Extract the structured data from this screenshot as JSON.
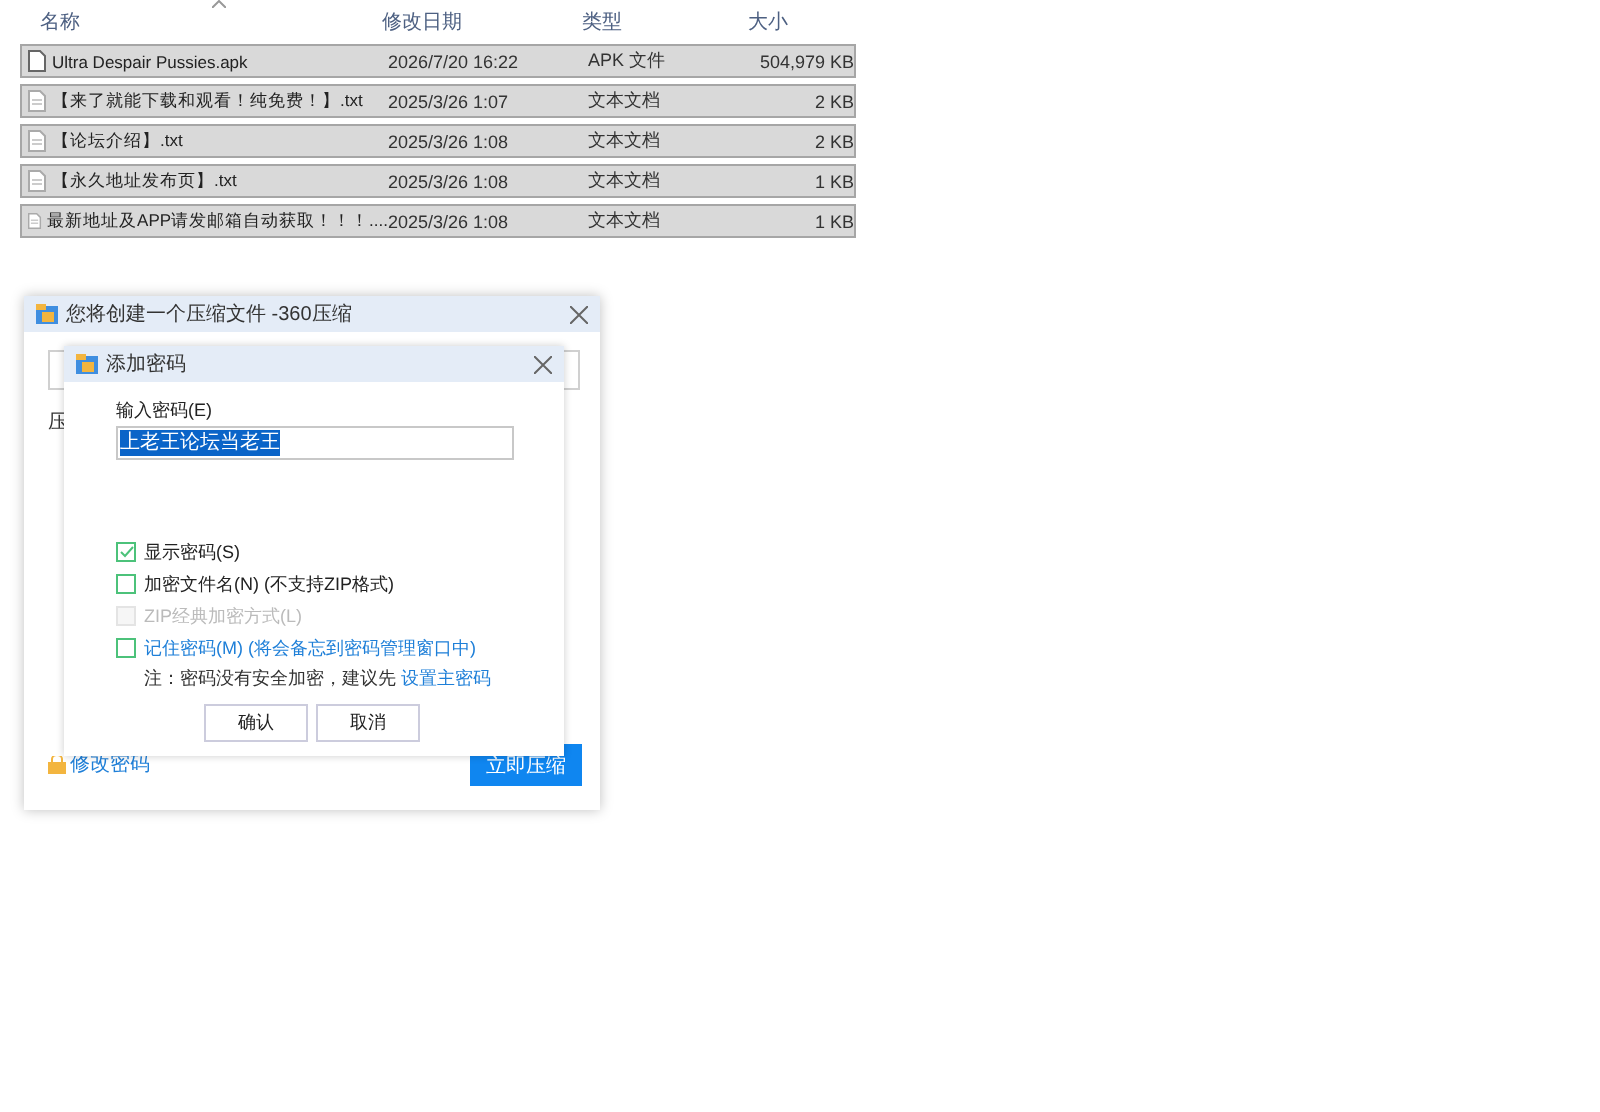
{
  "file_list": {
    "columns": [
      {
        "label": "名称",
        "sorted": true
      },
      {
        "label": "修改日期",
        "sorted": false
      },
      {
        "label": "类型",
        "sorted": false
      },
      {
        "label": "大小",
        "sorted": false
      }
    ],
    "rows": [
      {
        "kind": "apk",
        "name": "Ultra Despair Pussies.apk",
        "date": "2026/7/20 16:22",
        "type": "APK 文件",
        "size": "504,979 KB",
        "selected": true
      },
      {
        "kind": "text",
        "name": "【来了就能下载和观看！纯免费！】.txt",
        "date": "2025/3/26 1:07",
        "type": "文本文档",
        "size": "2 KB",
        "selected": true
      },
      {
        "kind": "text",
        "name": "【论坛介绍】.txt",
        "date": "2025/3/26 1:08",
        "type": "文本文档",
        "size": "2 KB",
        "selected": true
      },
      {
        "kind": "text",
        "name": "【永久地址发布页】.txt",
        "date": "2025/3/26 1:08",
        "type": "文本文档",
        "size": "1 KB",
        "selected": true
      },
      {
        "kind": "text",
        "name": "最新地址及APP请发邮箱自动获取！！！....",
        "date": "2025/3/26 1:08",
        "type": "文本文档",
        "size": "1 KB",
        "selected": true
      }
    ]
  },
  "archive_dialog": {
    "title": "您将创建一个压缩文件 -360压缩",
    "label_fragment": "压",
    "change_password_link": "修改密码",
    "compress_button": "立即压缩"
  },
  "password_dialog": {
    "title": "添加密码",
    "field_label": "输入密码(E)",
    "password_value": "上老王论坛当老王",
    "options": [
      {
        "kind": "plain",
        "label": "显示密码(S)",
        "checked": true,
        "disabled": false
      },
      {
        "kind": "plain",
        "label": "加密文件名(N) (不支持ZIP格式)",
        "checked": false,
        "disabled": false
      },
      {
        "kind": "plain",
        "label": "ZIP经典加密方式(L)",
        "checked": false,
        "disabled": true
      },
      {
        "kind": "link",
        "label": "记住密码(M) (将会备忘到密码管理窗口中)",
        "checked": false,
        "disabled": false
      }
    ],
    "note": "注：密码没有安全加密，建议先",
    "note_link": "设置主密码",
    "buttons": [
      "确认",
      "取消"
    ]
  }
}
